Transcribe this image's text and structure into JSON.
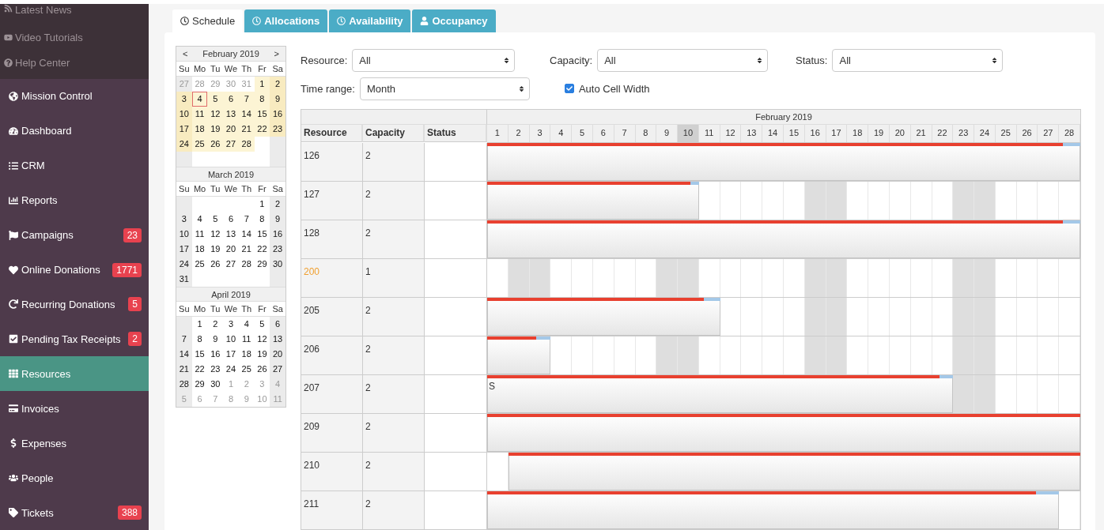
{
  "sidebar": {
    "top_links": [
      {
        "label": "Latest News"
      },
      {
        "label": "Video Tutorials"
      },
      {
        "label": "Help Center"
      }
    ],
    "items": [
      {
        "label": "Mission Control",
        "selected": false
      },
      {
        "label": "Dashboard",
        "selected": false
      },
      {
        "label": "CRM",
        "selected": false
      },
      {
        "label": "Reports",
        "selected": false
      },
      {
        "label": "Campaigns",
        "selected": false,
        "badge": "23"
      },
      {
        "label": "Online Donations",
        "selected": false,
        "badge": "1771"
      },
      {
        "label": "Recurring Donations",
        "selected": false,
        "badge": "5"
      },
      {
        "label": "Pending Tax Receipts",
        "selected": false,
        "badge": "2"
      },
      {
        "label": "Resources",
        "selected": true
      },
      {
        "label": "Invoices",
        "selected": false
      },
      {
        "label": "Expenses",
        "selected": false
      },
      {
        "label": "People",
        "selected": false
      },
      {
        "label": "Tickets",
        "selected": false,
        "badge": "388"
      }
    ]
  },
  "tabs": [
    {
      "label": "Schedule",
      "selected": true
    },
    {
      "label": "Allocations",
      "selected": false
    },
    {
      "label": "Availability",
      "selected": false
    },
    {
      "label": "Occupancy",
      "selected": false
    }
  ],
  "mini_calendars": [
    {
      "title": "February 2019",
      "prev": "<",
      "next": ">",
      "weekdays": [
        "Su",
        "Mo",
        "Tu",
        "We",
        "Th",
        "Fr",
        "Sa"
      ],
      "weeks": [
        [
          {
            "day": "27",
            "other_month": true,
            "in_range": false,
            "selected": false
          },
          {
            "day": "28",
            "other_month": true,
            "in_range": false,
            "selected": false
          },
          {
            "day": "29",
            "other_month": true,
            "in_range": false,
            "selected": false
          },
          {
            "day": "30",
            "other_month": true,
            "in_range": false,
            "selected": false
          },
          {
            "day": "31",
            "other_month": true,
            "in_range": false,
            "selected": false
          },
          {
            "day": "1",
            "other_month": false,
            "in_range": true,
            "selected": false
          },
          {
            "day": "2",
            "other_month": false,
            "in_range": true,
            "selected": false
          }
        ],
        [
          {
            "day": "3",
            "other_month": false,
            "in_range": true,
            "selected": false
          },
          {
            "day": "4",
            "other_month": false,
            "in_range": true,
            "selected": true
          },
          {
            "day": "5",
            "other_month": false,
            "in_range": true,
            "selected": false
          },
          {
            "day": "6",
            "other_month": false,
            "in_range": true,
            "selected": false
          },
          {
            "day": "7",
            "other_month": false,
            "in_range": true,
            "selected": false
          },
          {
            "day": "8",
            "other_month": false,
            "in_range": true,
            "selected": false
          },
          {
            "day": "9",
            "other_month": false,
            "in_range": true,
            "selected": false
          }
        ],
        [
          {
            "day": "10",
            "other_month": false,
            "in_range": true,
            "selected": false
          },
          {
            "day": "11",
            "other_month": false,
            "in_range": true,
            "selected": false
          },
          {
            "day": "12",
            "other_month": false,
            "in_range": true,
            "selected": false
          },
          {
            "day": "13",
            "other_month": false,
            "in_range": true,
            "selected": false
          },
          {
            "day": "14",
            "other_month": false,
            "in_range": true,
            "selected": false
          },
          {
            "day": "15",
            "other_month": false,
            "in_range": true,
            "selected": false
          },
          {
            "day": "16",
            "other_month": false,
            "in_range": true,
            "selected": false
          }
        ],
        [
          {
            "day": "17",
            "other_month": false,
            "in_range": true,
            "selected": false
          },
          {
            "day": "18",
            "other_month": false,
            "in_range": true,
            "selected": false
          },
          {
            "day": "19",
            "other_month": false,
            "in_range": true,
            "selected": false
          },
          {
            "day": "20",
            "other_month": false,
            "in_range": true,
            "selected": false
          },
          {
            "day": "21",
            "other_month": false,
            "in_range": true,
            "selected": false
          },
          {
            "day": "22",
            "other_month": false,
            "in_range": true,
            "selected": false
          },
          {
            "day": "23",
            "other_month": false,
            "in_range": true,
            "selected": false
          }
        ],
        [
          {
            "day": "24",
            "other_month": false,
            "in_range": true,
            "selected": false
          },
          {
            "day": "25",
            "other_month": false,
            "in_range": true,
            "selected": false
          },
          {
            "day": "26",
            "other_month": false,
            "in_range": true,
            "selected": false
          },
          {
            "day": "27",
            "other_month": false,
            "in_range": true,
            "selected": false
          },
          {
            "day": "28",
            "other_month": false,
            "in_range": true,
            "selected": false
          }
        ]
      ]
    },
    {
      "title": "March 2019",
      "weekdays": [
        "Su",
        "Mo",
        "Tu",
        "We",
        "Th",
        "Fr",
        "Sa"
      ],
      "weeks": [
        [
          {
            "day": "1",
            "other_month": false,
            "in_range": false,
            "selected": false
          },
          {
            "day": "2",
            "other_month": false,
            "in_range": false,
            "selected": false
          }
        ],
        [
          {
            "day": "3",
            "other_month": false,
            "in_range": false,
            "selected": false
          },
          {
            "day": "4",
            "other_month": false,
            "in_range": false,
            "selected": false
          },
          {
            "day": "5",
            "other_month": false,
            "in_range": false,
            "selected": false
          },
          {
            "day": "6",
            "other_month": false,
            "in_range": false,
            "selected": false
          },
          {
            "day": "7",
            "other_month": false,
            "in_range": false,
            "selected": false
          },
          {
            "day": "8",
            "other_month": false,
            "in_range": false,
            "selected": false
          },
          {
            "day": "9",
            "other_month": false,
            "in_range": false,
            "selected": false
          }
        ],
        [
          {
            "day": "10",
            "other_month": false,
            "in_range": false,
            "selected": false
          },
          {
            "day": "11",
            "other_month": false,
            "in_range": false,
            "selected": false
          },
          {
            "day": "12",
            "other_month": false,
            "in_range": false,
            "selected": false
          },
          {
            "day": "13",
            "other_month": false,
            "in_range": false,
            "selected": false
          },
          {
            "day": "14",
            "other_month": false,
            "in_range": false,
            "selected": false
          },
          {
            "day": "15",
            "other_month": false,
            "in_range": false,
            "selected": false
          },
          {
            "day": "16",
            "other_month": false,
            "in_range": false,
            "selected": false
          }
        ],
        [
          {
            "day": "17",
            "other_month": false,
            "in_range": false,
            "selected": false
          },
          {
            "day": "18",
            "other_month": false,
            "in_range": false,
            "selected": false
          },
          {
            "day": "19",
            "other_month": false,
            "in_range": false,
            "selected": false
          },
          {
            "day": "20",
            "other_month": false,
            "in_range": false,
            "selected": false
          },
          {
            "day": "21",
            "other_month": false,
            "in_range": false,
            "selected": false
          },
          {
            "day": "22",
            "other_month": false,
            "in_range": false,
            "selected": false
          },
          {
            "day": "23",
            "other_month": false,
            "in_range": false,
            "selected": false
          }
        ],
        [
          {
            "day": "24",
            "other_month": false,
            "in_range": false,
            "selected": false
          },
          {
            "day": "25",
            "other_month": false,
            "in_range": false,
            "selected": false
          },
          {
            "day": "26",
            "other_month": false,
            "in_range": false,
            "selected": false
          },
          {
            "day": "27",
            "other_month": false,
            "in_range": false,
            "selected": false
          },
          {
            "day": "28",
            "other_month": false,
            "in_range": false,
            "selected": false
          },
          {
            "day": "29",
            "other_month": false,
            "in_range": false,
            "selected": false
          },
          {
            "day": "30",
            "other_month": false,
            "in_range": false,
            "selected": false
          }
        ],
        [
          {
            "day": "31",
            "other_month": false,
            "in_range": false,
            "selected": false
          }
        ]
      ]
    },
    {
      "title": "April 2019",
      "weekdays": [
        "Su",
        "Mo",
        "Tu",
        "We",
        "Th",
        "Fr",
        "Sa"
      ],
      "weeks": [
        [
          {
            "day": "1",
            "other_month": false,
            "in_range": false,
            "selected": false
          },
          {
            "day": "2",
            "other_month": false,
            "in_range": false,
            "selected": false
          },
          {
            "day": "3",
            "other_month": false,
            "in_range": false,
            "selected": false
          },
          {
            "day": "4",
            "other_month": false,
            "in_range": false,
            "selected": false
          },
          {
            "day": "5",
            "other_month": false,
            "in_range": false,
            "selected": false
          },
          {
            "day": "6",
            "other_month": false,
            "in_range": false,
            "selected": false
          }
        ],
        [
          {
            "day": "7",
            "other_month": false,
            "in_range": false,
            "selected": false
          },
          {
            "day": "8",
            "other_month": false,
            "in_range": false,
            "selected": false
          },
          {
            "day": "9",
            "other_month": false,
            "in_range": false,
            "selected": false
          },
          {
            "day": "10",
            "other_month": false,
            "in_range": false,
            "selected": false
          },
          {
            "day": "11",
            "other_month": false,
            "in_range": false,
            "selected": false
          },
          {
            "day": "12",
            "other_month": false,
            "in_range": false,
            "selected": false
          },
          {
            "day": "13",
            "other_month": false,
            "in_range": false,
            "selected": false
          }
        ],
        [
          {
            "day": "14",
            "other_month": false,
            "in_range": false,
            "selected": false
          },
          {
            "day": "15",
            "other_month": false,
            "in_range": false,
            "selected": false
          },
          {
            "day": "16",
            "other_month": false,
            "in_range": false,
            "selected": false
          },
          {
            "day": "17",
            "other_month": false,
            "in_range": false,
            "selected": false
          },
          {
            "day": "18",
            "other_month": false,
            "in_range": false,
            "selected": false
          },
          {
            "day": "19",
            "other_month": false,
            "in_range": false,
            "selected": false
          },
          {
            "day": "20",
            "other_month": false,
            "in_range": false,
            "selected": false
          }
        ],
        [
          {
            "day": "21",
            "other_month": false,
            "in_range": false,
            "selected": false
          },
          {
            "day": "22",
            "other_month": false,
            "in_range": false,
            "selected": false
          },
          {
            "day": "23",
            "other_month": false,
            "in_range": false,
            "selected": false
          },
          {
            "day": "24",
            "other_month": false,
            "in_range": false,
            "selected": false
          },
          {
            "day": "25",
            "other_month": false,
            "in_range": false,
            "selected": false
          },
          {
            "day": "26",
            "other_month": false,
            "in_range": false,
            "selected": false
          },
          {
            "day": "27",
            "other_month": false,
            "in_range": false,
            "selected": false
          }
        ],
        [
          {
            "day": "28",
            "other_month": false,
            "in_range": false,
            "selected": false
          },
          {
            "day": "29",
            "other_month": false,
            "in_range": false,
            "selected": false
          },
          {
            "day": "30",
            "other_month": false,
            "in_range": false,
            "selected": false
          },
          {
            "day": "1",
            "other_month": true,
            "in_range": false,
            "selected": false
          },
          {
            "day": "2",
            "other_month": true,
            "in_range": false,
            "selected": false
          },
          {
            "day": "3",
            "other_month": true,
            "in_range": false,
            "selected": false
          },
          {
            "day": "4",
            "other_month": true,
            "in_range": false,
            "selected": false
          }
        ],
        [
          {
            "day": "5",
            "other_month": true,
            "in_range": false,
            "selected": false
          },
          {
            "day": "6",
            "other_month": true,
            "in_range": false,
            "selected": false
          },
          {
            "day": "7",
            "other_month": true,
            "in_range": false,
            "selected": false
          },
          {
            "day": "8",
            "other_month": true,
            "in_range": false,
            "selected": false
          },
          {
            "day": "9",
            "other_month": true,
            "in_range": false,
            "selected": false
          },
          {
            "day": "10",
            "other_month": true,
            "in_range": false,
            "selected": false
          },
          {
            "day": "11",
            "other_month": true,
            "in_range": false,
            "selected": false
          }
        ]
      ]
    }
  ],
  "filters": {
    "resource": {
      "label": "Resource:",
      "value": "All"
    },
    "capacity": {
      "label": "Capacity:",
      "value": "All"
    },
    "status": {
      "label": "Status:",
      "value": "All"
    },
    "time_range": {
      "label": "Time range:",
      "value": "Month"
    },
    "auto_cell_width": {
      "label": "Auto Cell Width",
      "checked": true
    }
  },
  "scheduler": {
    "month": "February 2019",
    "columns": [
      "Resource",
      "Capacity",
      "Status"
    ],
    "days": [
      {
        "label": "1",
        "weekend": false,
        "today": false
      },
      {
        "label": "2",
        "weekend": true,
        "today": false
      },
      {
        "label": "3",
        "weekend": true,
        "today": false
      },
      {
        "label": "4",
        "weekend": false,
        "today": false
      },
      {
        "label": "5",
        "weekend": false,
        "today": false
      },
      {
        "label": "6",
        "weekend": false,
        "today": false
      },
      {
        "label": "7",
        "weekend": false,
        "today": false
      },
      {
        "label": "8",
        "weekend": false,
        "today": false
      },
      {
        "label": "9",
        "weekend": true,
        "today": false
      },
      {
        "label": "10",
        "weekend": true,
        "today": true
      },
      {
        "label": "11",
        "weekend": false,
        "today": false
      },
      {
        "label": "12",
        "weekend": false,
        "today": false
      },
      {
        "label": "13",
        "weekend": false,
        "today": false
      },
      {
        "label": "14",
        "weekend": false,
        "today": false
      },
      {
        "label": "15",
        "weekend": false,
        "today": false
      },
      {
        "label": "16",
        "weekend": true,
        "today": false
      },
      {
        "label": "17",
        "weekend": true,
        "today": false
      },
      {
        "label": "18",
        "weekend": false,
        "today": false
      },
      {
        "label": "19",
        "weekend": false,
        "today": false
      },
      {
        "label": "20",
        "weekend": false,
        "today": false
      },
      {
        "label": "21",
        "weekend": false,
        "today": false
      },
      {
        "label": "22",
        "weekend": false,
        "today": false
      },
      {
        "label": "23",
        "weekend": true,
        "today": false
      },
      {
        "label": "24",
        "weekend": true,
        "today": false
      },
      {
        "label": "25",
        "weekend": false,
        "today": false
      },
      {
        "label": "26",
        "weekend": false,
        "today": false
      },
      {
        "label": "27",
        "weekend": false,
        "today": false
      },
      {
        "label": "28",
        "weekend": false,
        "today": false
      }
    ],
    "rows": [
      {
        "resource": "126",
        "capacity": "2",
        "highlighted": false,
        "bookings": [
          {
            "level": 0.97
          }
        ],
        "booked_days": [
          true,
          true,
          true,
          true,
          true,
          true,
          true,
          true,
          true,
          true,
          true,
          true,
          true,
          true,
          true,
          true,
          true,
          true,
          true,
          true,
          true,
          true,
          true,
          true,
          true,
          true,
          true,
          true
        ]
      },
      {
        "resource": "127",
        "capacity": "2",
        "highlighted": false,
        "bookings": [
          {
            "level": 0.96
          }
        ],
        "booked_days": [
          true,
          true,
          true,
          true,
          true,
          true,
          true,
          true,
          true,
          true,
          false,
          false,
          false,
          false,
          false,
          false,
          false,
          false,
          false,
          false,
          false,
          false,
          false,
          false,
          false,
          false,
          false,
          false
        ]
      },
      {
        "resource": "128",
        "capacity": "2",
        "highlighted": false,
        "bookings": [
          {
            "level": 0.97
          }
        ],
        "booked_days": [
          true,
          true,
          true,
          true,
          true,
          true,
          true,
          true,
          true,
          true,
          true,
          true,
          true,
          true,
          true,
          true,
          true,
          true,
          true,
          true,
          true,
          true,
          true,
          true,
          true,
          true,
          true,
          true
        ]
      },
      {
        "resource": "200",
        "capacity": "1",
        "highlighted": true,
        "bookings": [],
        "booked_days": [
          false,
          false,
          false,
          false,
          false,
          false,
          false,
          false,
          false,
          false,
          false,
          false,
          false,
          false,
          false,
          false,
          false,
          false,
          false,
          false,
          false,
          false,
          false,
          false,
          false,
          false,
          false,
          false
        ]
      },
      {
        "resource": "205",
        "capacity": "2",
        "highlighted": false,
        "bookings": [
          {
            "level": 0.93
          }
        ],
        "booked_days": [
          true,
          true,
          true,
          true,
          true,
          true,
          true,
          true,
          true,
          true,
          true,
          false,
          false,
          false,
          false,
          false,
          false,
          false,
          false,
          false,
          false,
          false,
          false,
          false,
          false,
          false,
          false,
          false
        ]
      },
      {
        "resource": "206",
        "capacity": "2",
        "highlighted": false,
        "bookings": [
          {
            "level": 0.77
          }
        ],
        "booked_days": [
          true,
          true,
          true,
          false,
          false,
          false,
          false,
          false,
          false,
          false,
          false,
          false,
          false,
          false,
          false,
          false,
          false,
          false,
          false,
          false,
          false,
          false,
          false,
          false,
          false,
          false,
          false,
          false
        ]
      },
      {
        "resource": "207",
        "capacity": "2",
        "highlighted": false,
        "bookings": [
          {
            "level": 0.97,
            "label": "S"
          }
        ],
        "booked_days": [
          true,
          true,
          true,
          true,
          true,
          true,
          true,
          true,
          true,
          true,
          true,
          true,
          true,
          true,
          true,
          true,
          true,
          true,
          true,
          true,
          true,
          true,
          false,
          false,
          false,
          false,
          false,
          false
        ]
      },
      {
        "resource": "209",
        "capacity": "2",
        "highlighted": false,
        "bookings": [
          {
            "level": 1
          }
        ],
        "booked_days": [
          true,
          true,
          true,
          true,
          true,
          true,
          true,
          true,
          true,
          true,
          true,
          true,
          true,
          true,
          true,
          true,
          true,
          true,
          true,
          true,
          true,
          true,
          true,
          true,
          true,
          true,
          true,
          true
        ]
      },
      {
        "resource": "210",
        "capacity": "2",
        "highlighted": false,
        "bookings": [
          {
            "level": 1
          }
        ],
        "booked_days": [
          false,
          true,
          true,
          true,
          true,
          true,
          true,
          true,
          true,
          true,
          true,
          true,
          true,
          true,
          true,
          true,
          true,
          true,
          true,
          true,
          true,
          true,
          true,
          true,
          true,
          true,
          true,
          true
        ]
      },
      {
        "resource": "211",
        "capacity": "2",
        "highlighted": false,
        "bookings": [
          {
            "level": 0.96
          }
        ],
        "booked_days": [
          true,
          true,
          true,
          true,
          true,
          true,
          true,
          true,
          true,
          true,
          true,
          true,
          true,
          true,
          true,
          true,
          true,
          true,
          true,
          true,
          true,
          true,
          true,
          true,
          true,
          true,
          true,
          false
        ]
      }
    ]
  }
}
